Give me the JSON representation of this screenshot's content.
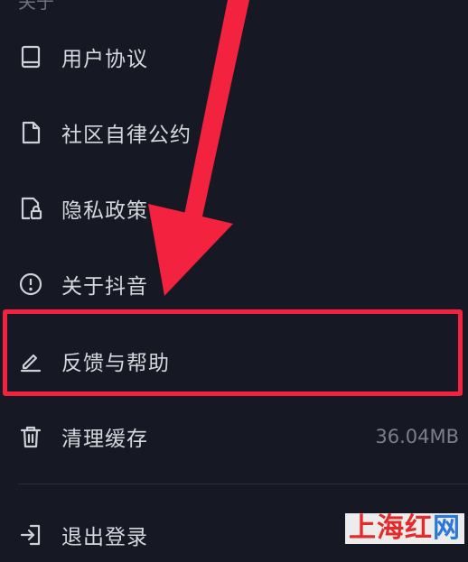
{
  "section": {
    "label": "关于"
  },
  "menu": {
    "items": [
      {
        "label": "用户协议",
        "icon": "book-icon"
      },
      {
        "label": "社区自律公约",
        "icon": "document-icon"
      },
      {
        "label": "隐私政策",
        "icon": "privacy-lock-icon"
      },
      {
        "label": "关于抖音",
        "icon": "info-icon"
      },
      {
        "label": "反馈与帮助",
        "icon": "edit-pen-icon"
      },
      {
        "label": "清理缓存",
        "icon": "trash-icon",
        "value": "36.04MB"
      },
      {
        "label": "退出登录",
        "icon": "logout-icon"
      }
    ]
  },
  "annotation": {
    "highlight_color": "#f3223e",
    "arrow_color": "#f3223e"
  },
  "watermark": {
    "part1": "上海",
    "part2": "红",
    "part3": "网"
  },
  "colors": {
    "background": "#161824",
    "text": "#d6d7dc",
    "muted": "#7c7e88"
  }
}
